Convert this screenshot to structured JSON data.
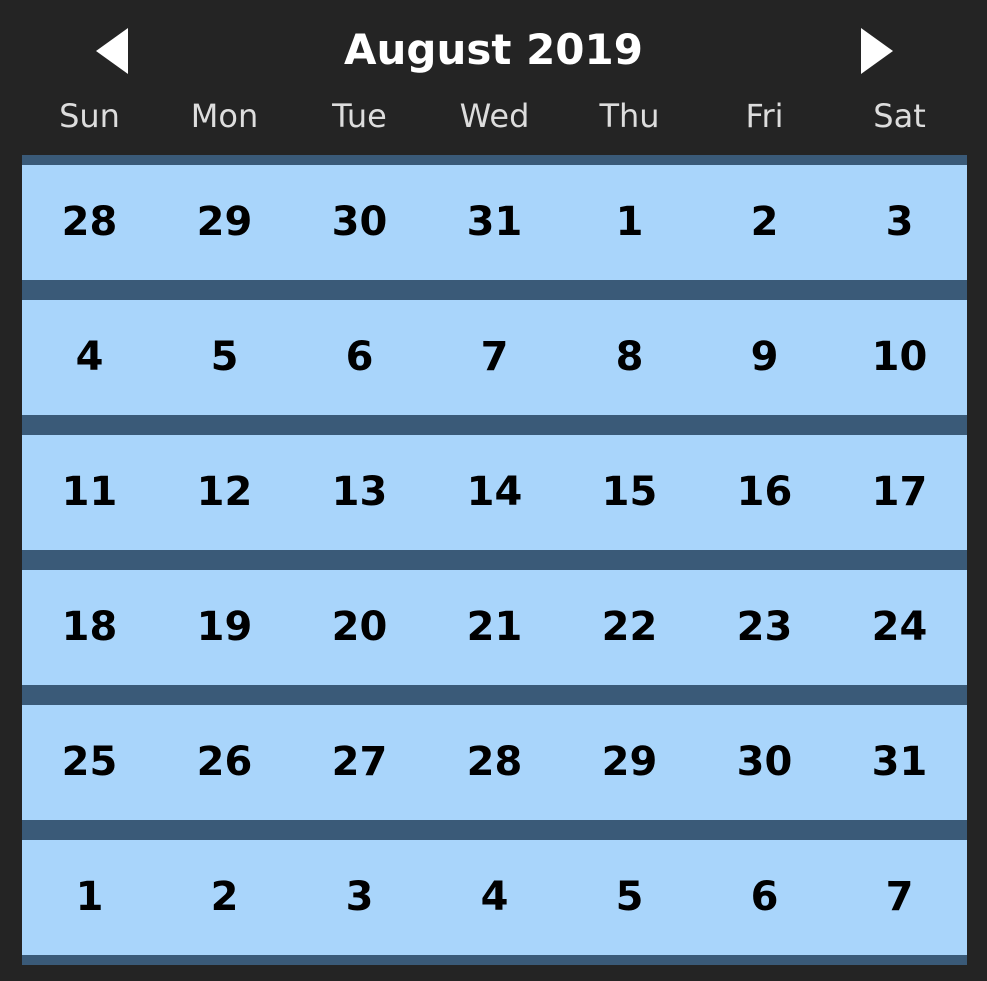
{
  "header": {
    "title": "August 2019",
    "prev_icon": "chevron-left-icon",
    "next_icon": "chevron-right-icon"
  },
  "weekdays": [
    "Sun",
    "Mon",
    "Tue",
    "Wed",
    "Thu",
    "Fri",
    "Sat"
  ],
  "weeks": [
    [
      "28",
      "29",
      "30",
      "31",
      "1",
      "2",
      "3"
    ],
    [
      "4",
      "5",
      "6",
      "7",
      "8",
      "9",
      "10"
    ],
    [
      "11",
      "12",
      "13",
      "14",
      "15",
      "16",
      "17"
    ],
    [
      "18",
      "19",
      "20",
      "21",
      "22",
      "23",
      "24"
    ],
    [
      "25",
      "26",
      "27",
      "28",
      "29",
      "30",
      "31"
    ],
    [
      "1",
      "2",
      "3",
      "4",
      "5",
      "6",
      "7"
    ]
  ],
  "colors": {
    "background": "#242424",
    "row_band": "#3a5a78",
    "row": "#a9d5fb"
  }
}
